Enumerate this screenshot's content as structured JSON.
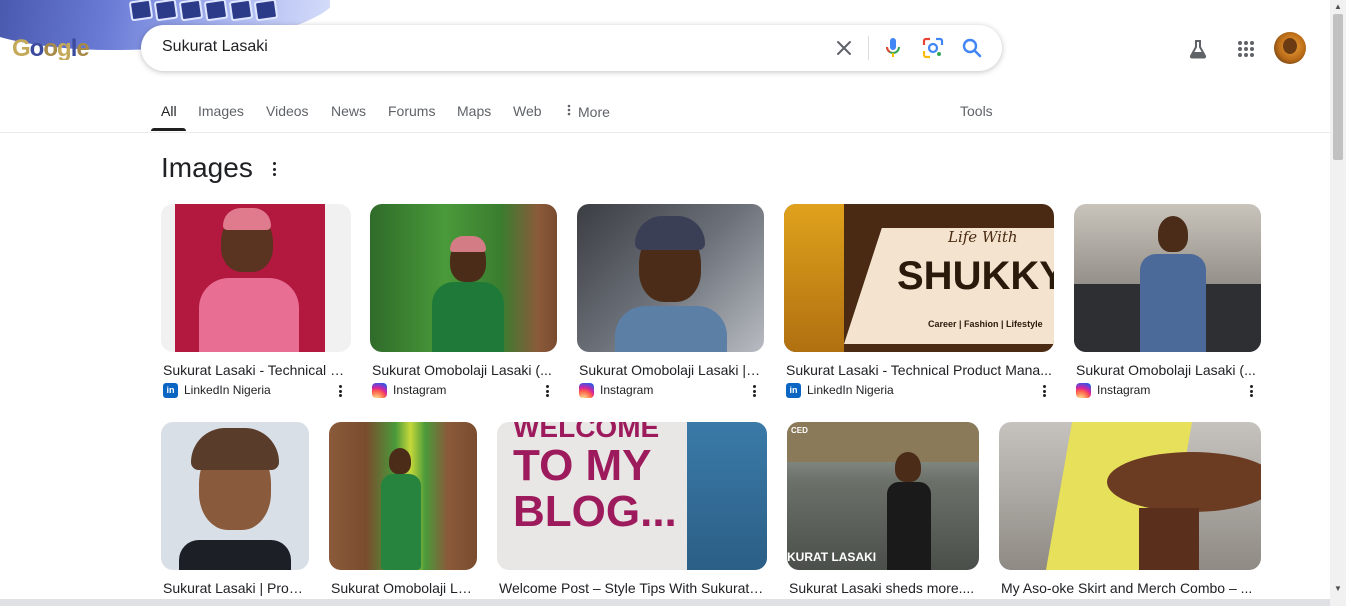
{
  "search": {
    "query": "Sukurat Lasaki"
  },
  "tabs": [
    {
      "label": "All",
      "active": true
    },
    {
      "label": "Images"
    },
    {
      "label": "Videos"
    },
    {
      "label": "News"
    },
    {
      "label": "Forums"
    },
    {
      "label": "Maps"
    },
    {
      "label": "Web"
    },
    {
      "label": "More"
    }
  ],
  "tools_label": "Tools",
  "images_section": {
    "title": "Images",
    "row1": [
      {
        "caption": "Sukurat Lasaki - Technical P...",
        "source": "LinkedIn Nigeria",
        "source_type": "linkedin"
      },
      {
        "caption": "Sukurat Omobolaji Lasaki (...",
        "source": "Instagram",
        "source_type": "instagram"
      },
      {
        "caption": "Sukurat Omobolaji Lasaki | I...",
        "source": "Instagram",
        "source_type": "instagram"
      },
      {
        "caption": "Sukurat Lasaki - Technical Product Mana...",
        "source": "LinkedIn Nigeria",
        "source_type": "linkedin",
        "overlay_script": "Life With",
        "overlay_title": "SHUKKY",
        "overlay_tagline": "Career | Fashion | Lifestyle"
      },
      {
        "caption": "Sukurat Omobolaji Lasaki (...",
        "source": "Instagram",
        "source_type": "instagram"
      }
    ],
    "row2": [
      {
        "caption": "Sukurat Lasaki | Prod..."
      },
      {
        "caption": "Sukurat Omobolaji La..."
      },
      {
        "caption": "Welcome Post – Style Tips With Sukurat L...",
        "overlay_lines": [
          "WELCOME",
          "TO MY",
          "BLOG..."
        ]
      },
      {
        "caption": "Sukurat Lasaki sheds more....",
        "overlay_text": "KURAT LASAKI",
        "overlay_badge": "CED"
      },
      {
        "caption": "My Aso-oke Skirt and Merch Combo – ..."
      }
    ]
  },
  "colors": {
    "accent_blue": "#1a73e8",
    "mic_red": "#ea4335",
    "linkedin": "#0a66c2"
  },
  "icons": {
    "clear": "close-icon",
    "voice": "mic-icon",
    "lens": "lens-icon",
    "search": "search-icon",
    "labs": "flask-icon",
    "apps": "apps-grid-icon"
  }
}
